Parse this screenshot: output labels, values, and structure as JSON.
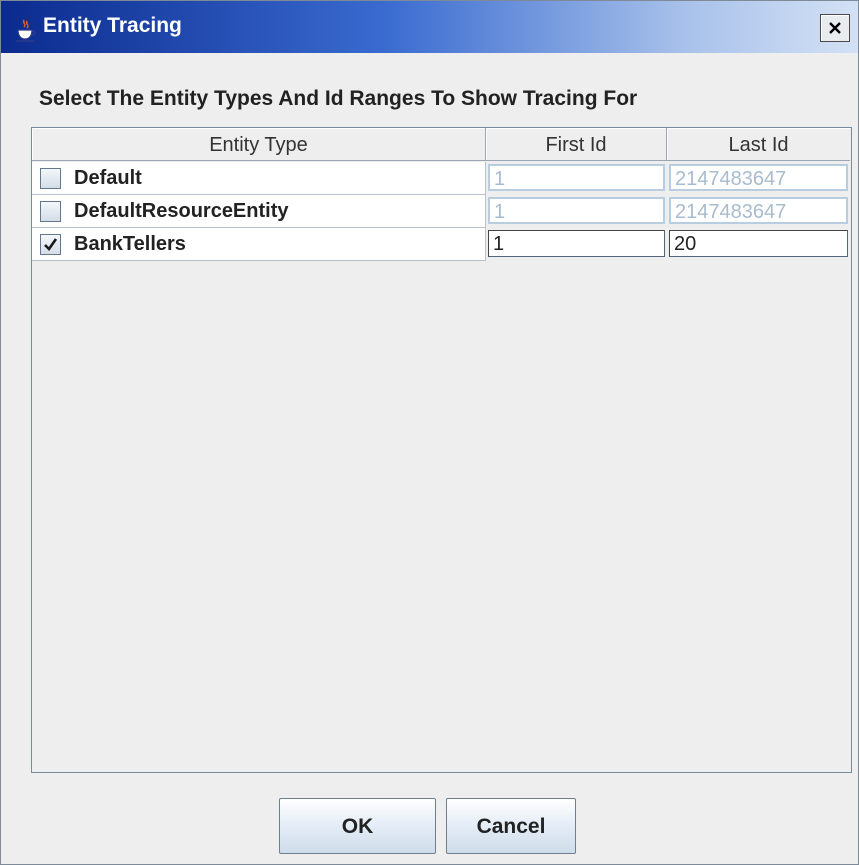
{
  "window": {
    "title": "Entity Tracing",
    "icon": "java-cup-icon",
    "close_label": "close"
  },
  "heading": "Select The Entity Types And Id Ranges To Show Tracing For",
  "table": {
    "columns": [
      "Entity Type",
      "First Id",
      "Last Id"
    ],
    "rows": [
      {
        "name": "Default",
        "checked": false,
        "first_id": "1",
        "last_id": "2147483647",
        "enabled": false
      },
      {
        "name": "DefaultResourceEntity",
        "checked": false,
        "first_id": "1",
        "last_id": "2147483647",
        "enabled": false
      },
      {
        "name": "BankTellers",
        "checked": true,
        "first_id": "1",
        "last_id": "20",
        "enabled": true
      }
    ]
  },
  "buttons": {
    "ok": "OK",
    "cancel": "Cancel"
  },
  "colors": {
    "title_bar_start": "#0b2a8e",
    "title_bar_end": "#d3e1f5",
    "disabled_text": "#a8bccf"
  }
}
